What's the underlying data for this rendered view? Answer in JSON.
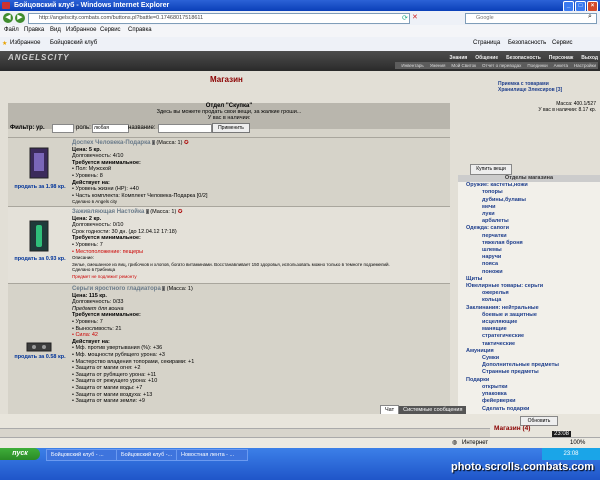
{
  "window": {
    "title": "Бойцовский клуб - Windows Internet Explorer"
  },
  "browser": {
    "url": "http://angelscity.combats.com/buttons.pl?battle=0.17468017518611",
    "search_placeholder": "Google",
    "menu": [
      "Файл",
      "Правка",
      "Вид",
      "Избранное",
      "Сервис",
      "Справка"
    ],
    "favorites_label": "Избранное",
    "tab_label": "Бойцовский клуб",
    "cmd": [
      "Страница",
      "Безопасность",
      "Сервис"
    ]
  },
  "game": {
    "logo": "ANGELSCITY",
    "topnav": [
      "Знания",
      "Общение",
      "Безопасность",
      "Персонаж",
      "Выход"
    ],
    "subnav": [
      "Инвентарь",
      "Умения",
      "Мой Свиток",
      "Отчет о переводах",
      "Поединки",
      "Анкета",
      "Настройки"
    ]
  },
  "shop": {
    "title": "Магазин",
    "right": {
      "row1": "Приемка с товарами",
      "row2": "Хранилище Элексиров [3]",
      "mass": "Масса: 400.1/527",
      "money": "У вас в наличии: 8.17 кр."
    },
    "dept_title": "Отдел \"Скупка\"",
    "dept_line1": "Здесь вы можете продать свои вещи, за жалкие гроши...",
    "dept_line2": "У вас в наличии:",
    "filter": {
      "label": "Фильтр: ур.",
      "role_label": "роль:",
      "role_value": "любая",
      "name_label": "название:",
      "apply": "Применить"
    },
    "items": [
      {
        "name": "Доспех Человека-Подарка",
        "mass": "(Масса: 1)",
        "price": "Цена: 5 кр.",
        "durability": "Долговечность: 4/10",
        "req_title": "Требуется минимальное:",
        "req": [
          "• Пол: Мужской",
          "• Уровень: 8"
        ],
        "acts_title": "Действует на:",
        "acts": [
          "• Уровень жизни (HP): +40",
          "• Часть комплекта: Комплект Человека-Подарка [0/2]"
        ],
        "made": "Сделано в Angels city",
        "sell": "продать за 1.98 кр."
      },
      {
        "name": "Заживляющая Настойка",
        "mass": "(Масса: 1)",
        "price": "Цена: 2 кр.",
        "durability": "Долговечность: 0/10",
        "term": "Срок годности: 30 дн. (до 12.04.12 17:18)",
        "req_title": "Требуется минимальное:",
        "req": [
          "• Уровень: 7",
          "• Местоположение: пещеры"
        ],
        "desc_title": "Описание:",
        "desc": "Зелье, смешанное из яиц, грибочков и хлопов, богато витаминами. Восстанавливает 150 здоровья, использовать можно только в темноте подземелий.",
        "made": "Сделано в Грибница",
        "note": "Предмет не подлежит ремонту",
        "sell": "продать за 0.93 кр."
      },
      {
        "name": "Серьги яростного гладиатора",
        "mass": "(Масса: 1)",
        "price": "Цена: 115 кр.",
        "durability": "Долговечность: 0/33",
        "purpose": "Предмет для воина",
        "req_title": "Требуется минимальное:",
        "req": [
          "• Уровень: 7",
          "• Выносливость: 21",
          "• Сила: 42"
        ],
        "acts_title": "Действует на:",
        "acts": [
          "• Мф. против увертывания (%): +36",
          "• Мф. мощности рубящего урона: +3",
          "• Мастерство владения топорами, секирами: +1",
          "• Защита от магии огня: +2",
          "• Защита от рубящего урона: +11",
          "• Защита от режущего урона: +10",
          "• Защита от магии воды: +7",
          "• Защита от магии воздуха: +13",
          "• Защита от магии земли: +9"
        ],
        "sell": "продать за 0.58 кр."
      }
    ],
    "buy_button": "Купить вещи",
    "cats_header": "Отделы магазина",
    "cats": [
      {
        "t": "c",
        "label": "Оружие: кастеты,ножи"
      },
      {
        "t": "s",
        "label": "топоры"
      },
      {
        "t": "s",
        "label": "дубины,булавы"
      },
      {
        "t": "s",
        "label": "мечи"
      },
      {
        "t": "s",
        "label": "луки"
      },
      {
        "t": "s",
        "label": "арбалеты"
      },
      {
        "t": "c",
        "label": "Одежда: сапоги"
      },
      {
        "t": "s",
        "label": "перчатки"
      },
      {
        "t": "s",
        "label": "тяжелая броня"
      },
      {
        "t": "s",
        "label": "шлемы"
      },
      {
        "t": "s",
        "label": "наручи"
      },
      {
        "t": "s",
        "label": "пояса"
      },
      {
        "t": "s",
        "label": "поножи"
      },
      {
        "t": "c",
        "label": "Щиты"
      },
      {
        "t": "c",
        "label": "Ювелирные товары: серьги"
      },
      {
        "t": "s",
        "label": "ожерелья"
      },
      {
        "t": "s",
        "label": "кольца"
      },
      {
        "t": "c",
        "label": "Заклинания: нейтральные"
      },
      {
        "t": "s",
        "label": "боевые и защитные"
      },
      {
        "t": "s",
        "label": "исцеляющие"
      },
      {
        "t": "s",
        "label": "манящие"
      },
      {
        "t": "s",
        "label": "стратегические"
      },
      {
        "t": "s",
        "label": "тактические"
      },
      {
        "t": "c",
        "label": "Амуниция"
      },
      {
        "t": "s",
        "label": "Сумки"
      },
      {
        "t": "s",
        "label": "Дополнительные предметы"
      },
      {
        "t": "s",
        "label": "Странные предметы"
      },
      {
        "t": "c",
        "label": "Подарки"
      },
      {
        "t": "s",
        "label": "открытки"
      },
      {
        "t": "s",
        "label": "упаковка"
      },
      {
        "t": "s",
        "label": "фейерверки"
      },
      {
        "t": "s",
        "label": "Сделать подарки"
      }
    ],
    "chat_tabs": [
      "Чат",
      "Системные сообщения"
    ],
    "refresh": "Обновить",
    "room": "Магазин (4)",
    "clock": "23:08"
  },
  "status": {
    "zone": "Интернет",
    "zoom": "100%"
  },
  "taskbar": {
    "start": "пуск",
    "tasks": [
      "Бойцовский клуб - ...",
      "Бойцовский клуб -...",
      "Новостная лента - ..."
    ],
    "time": "23:08",
    "watermark": "photo.scrolls.combats.com"
  }
}
